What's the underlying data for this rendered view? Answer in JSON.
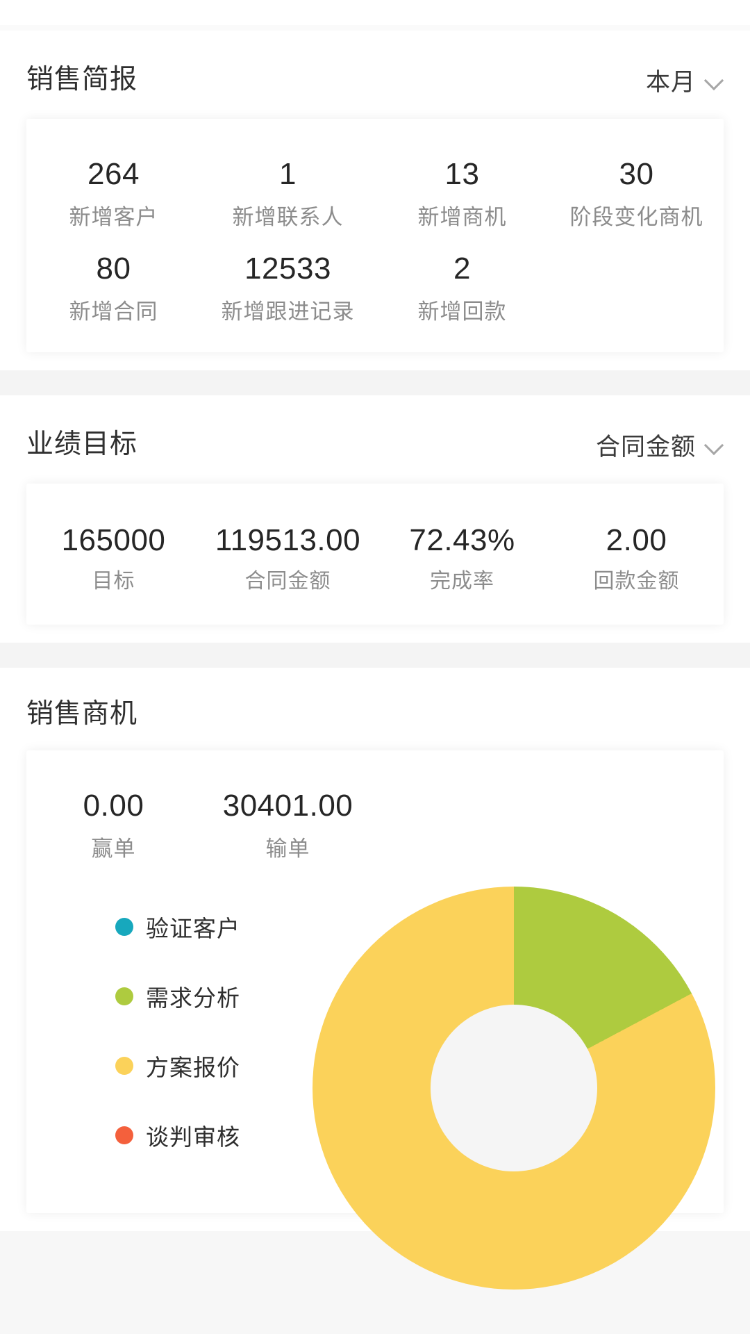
{
  "theme": {
    "page_bg": "#f7f7f7",
    "card_bg": "#ffffff",
    "value_color": "#262626",
    "label_color": "#8c8c8c"
  },
  "briefing": {
    "title": "销售简报",
    "period_filter": {
      "label": "本月",
      "icon": "chevron-down-icon"
    },
    "stats_row1": [
      {
        "value": "264",
        "label": "新增客户"
      },
      {
        "value": "1",
        "label": "新增联系人"
      },
      {
        "value": "13",
        "label": "新增商机"
      },
      {
        "value": "30",
        "label": "阶段变化商机"
      }
    ],
    "stats_row2": [
      {
        "value": "80",
        "label": "新增合同"
      },
      {
        "value": "12533",
        "label": "新增跟进记录"
      },
      {
        "value": "2",
        "label": "新增回款"
      }
    ]
  },
  "target": {
    "title": "业绩目标",
    "metric_filter": {
      "label": "合同金额",
      "icon": "chevron-down-icon"
    },
    "stats": [
      {
        "value": "165000",
        "label": "目标"
      },
      {
        "value": "119513.00",
        "label": "合同金额"
      },
      {
        "value": "72.43%",
        "label": "完成率"
      },
      {
        "value": "2.00",
        "label": "回款金额"
      }
    ]
  },
  "opportunity": {
    "title": "销售商机",
    "stats": [
      {
        "value": "0.00",
        "label": "赢单"
      },
      {
        "value": "30401.00",
        "label": "输单"
      }
    ],
    "legend": [
      {
        "label": "验证客户",
        "color": "#17a8bd"
      },
      {
        "label": "需求分析",
        "color": "#aecb3f"
      },
      {
        "label": "方案报价",
        "color": "#fbd25a"
      },
      {
        "label": "谈判审核",
        "color": "#f4603c"
      }
    ]
  },
  "chart_data": {
    "type": "pie",
    "title": "销售商机",
    "subtype": "donut",
    "hole_ratio": 0.41,
    "start_angle_deg": 0,
    "direction": "clockwise",
    "categories": [
      "验证客户",
      "需求分析",
      "方案报价",
      "谈判审核"
    ],
    "values": [
      0,
      17.2,
      82.8,
      0
    ],
    "value_unit": "percent",
    "colors": [
      "#17a8bd",
      "#aecb3f",
      "#fbd25a",
      "#f4603c"
    ],
    "slice_angles_deg": [
      0,
      62,
      298,
      0
    ],
    "legend_position": "left",
    "grid": false,
    "annotations": [
      {
        "text": "0.00",
        "label": "赢单"
      },
      {
        "text": "30401.00",
        "label": "输单"
      }
    ]
  }
}
